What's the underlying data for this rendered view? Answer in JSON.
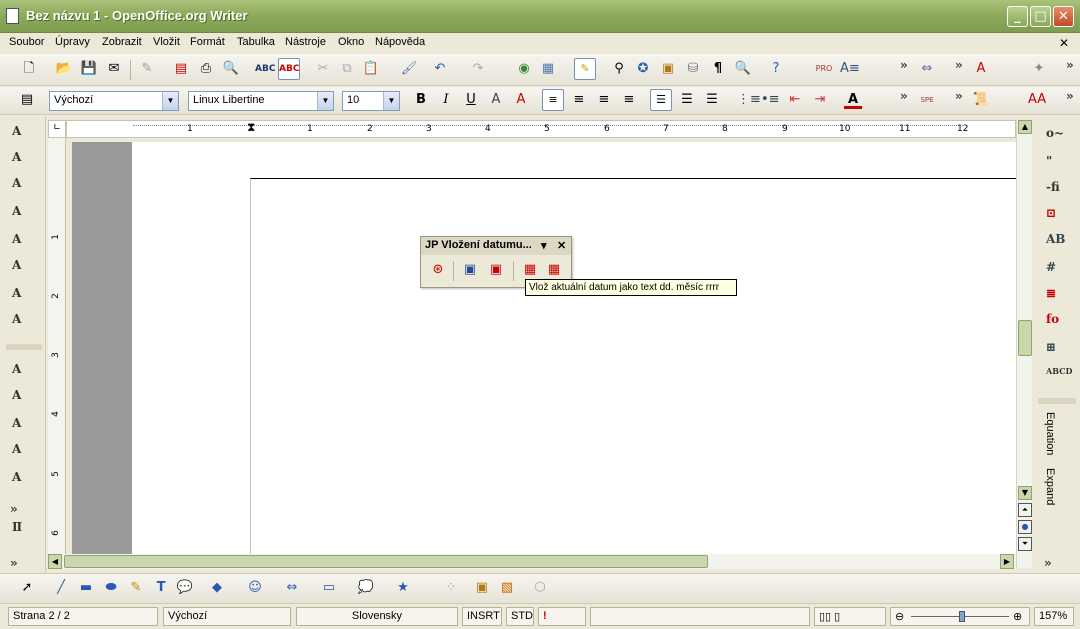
{
  "window": {
    "title": "Bez názvu 1 - OpenOffice.org Writer",
    "minimize": "_",
    "maximize": "□",
    "close": "✕"
  },
  "menubar": {
    "items": [
      "Soubor",
      "Úpravy",
      "Zobrazit",
      "Vložit",
      "Formát",
      "Tabulka",
      "Nástroje",
      "Okno",
      "Nápověda"
    ],
    "close_doc": "✕"
  },
  "format_toolbar": {
    "style": "Výchozí",
    "font": "Linux Libertine",
    "size": "10"
  },
  "floating_toolbar": {
    "title": "JP Vložení datumu...",
    "menu_arrow": "▾",
    "close": "✕"
  },
  "tooltip": {
    "text": "Vlož aktuální datum jako text dd. měsíc rrrr"
  },
  "ruler": {
    "h_ticks": [
      "1",
      "1",
      "2",
      "3",
      "4",
      "5",
      "6",
      "7",
      "8",
      "9",
      "10",
      "11",
      "12"
    ],
    "v_ticks": [
      "1",
      "2",
      "3",
      "4",
      "5",
      "6"
    ]
  },
  "right_panel": {
    "labels": [
      "Equation",
      "Expand"
    ]
  },
  "statusbar": {
    "page": "Strana 2 / 2",
    "style": "Výchozí",
    "language": "Slovensky",
    "insert_mode": "INSRT",
    "selection_mode": "STD",
    "zoom": "157%"
  },
  "colors": {
    "titlebar": "#8eab5c",
    "toolbar": "#ece9d8",
    "page": "#ffffff",
    "gray_margin": "#9a9a9a"
  }
}
